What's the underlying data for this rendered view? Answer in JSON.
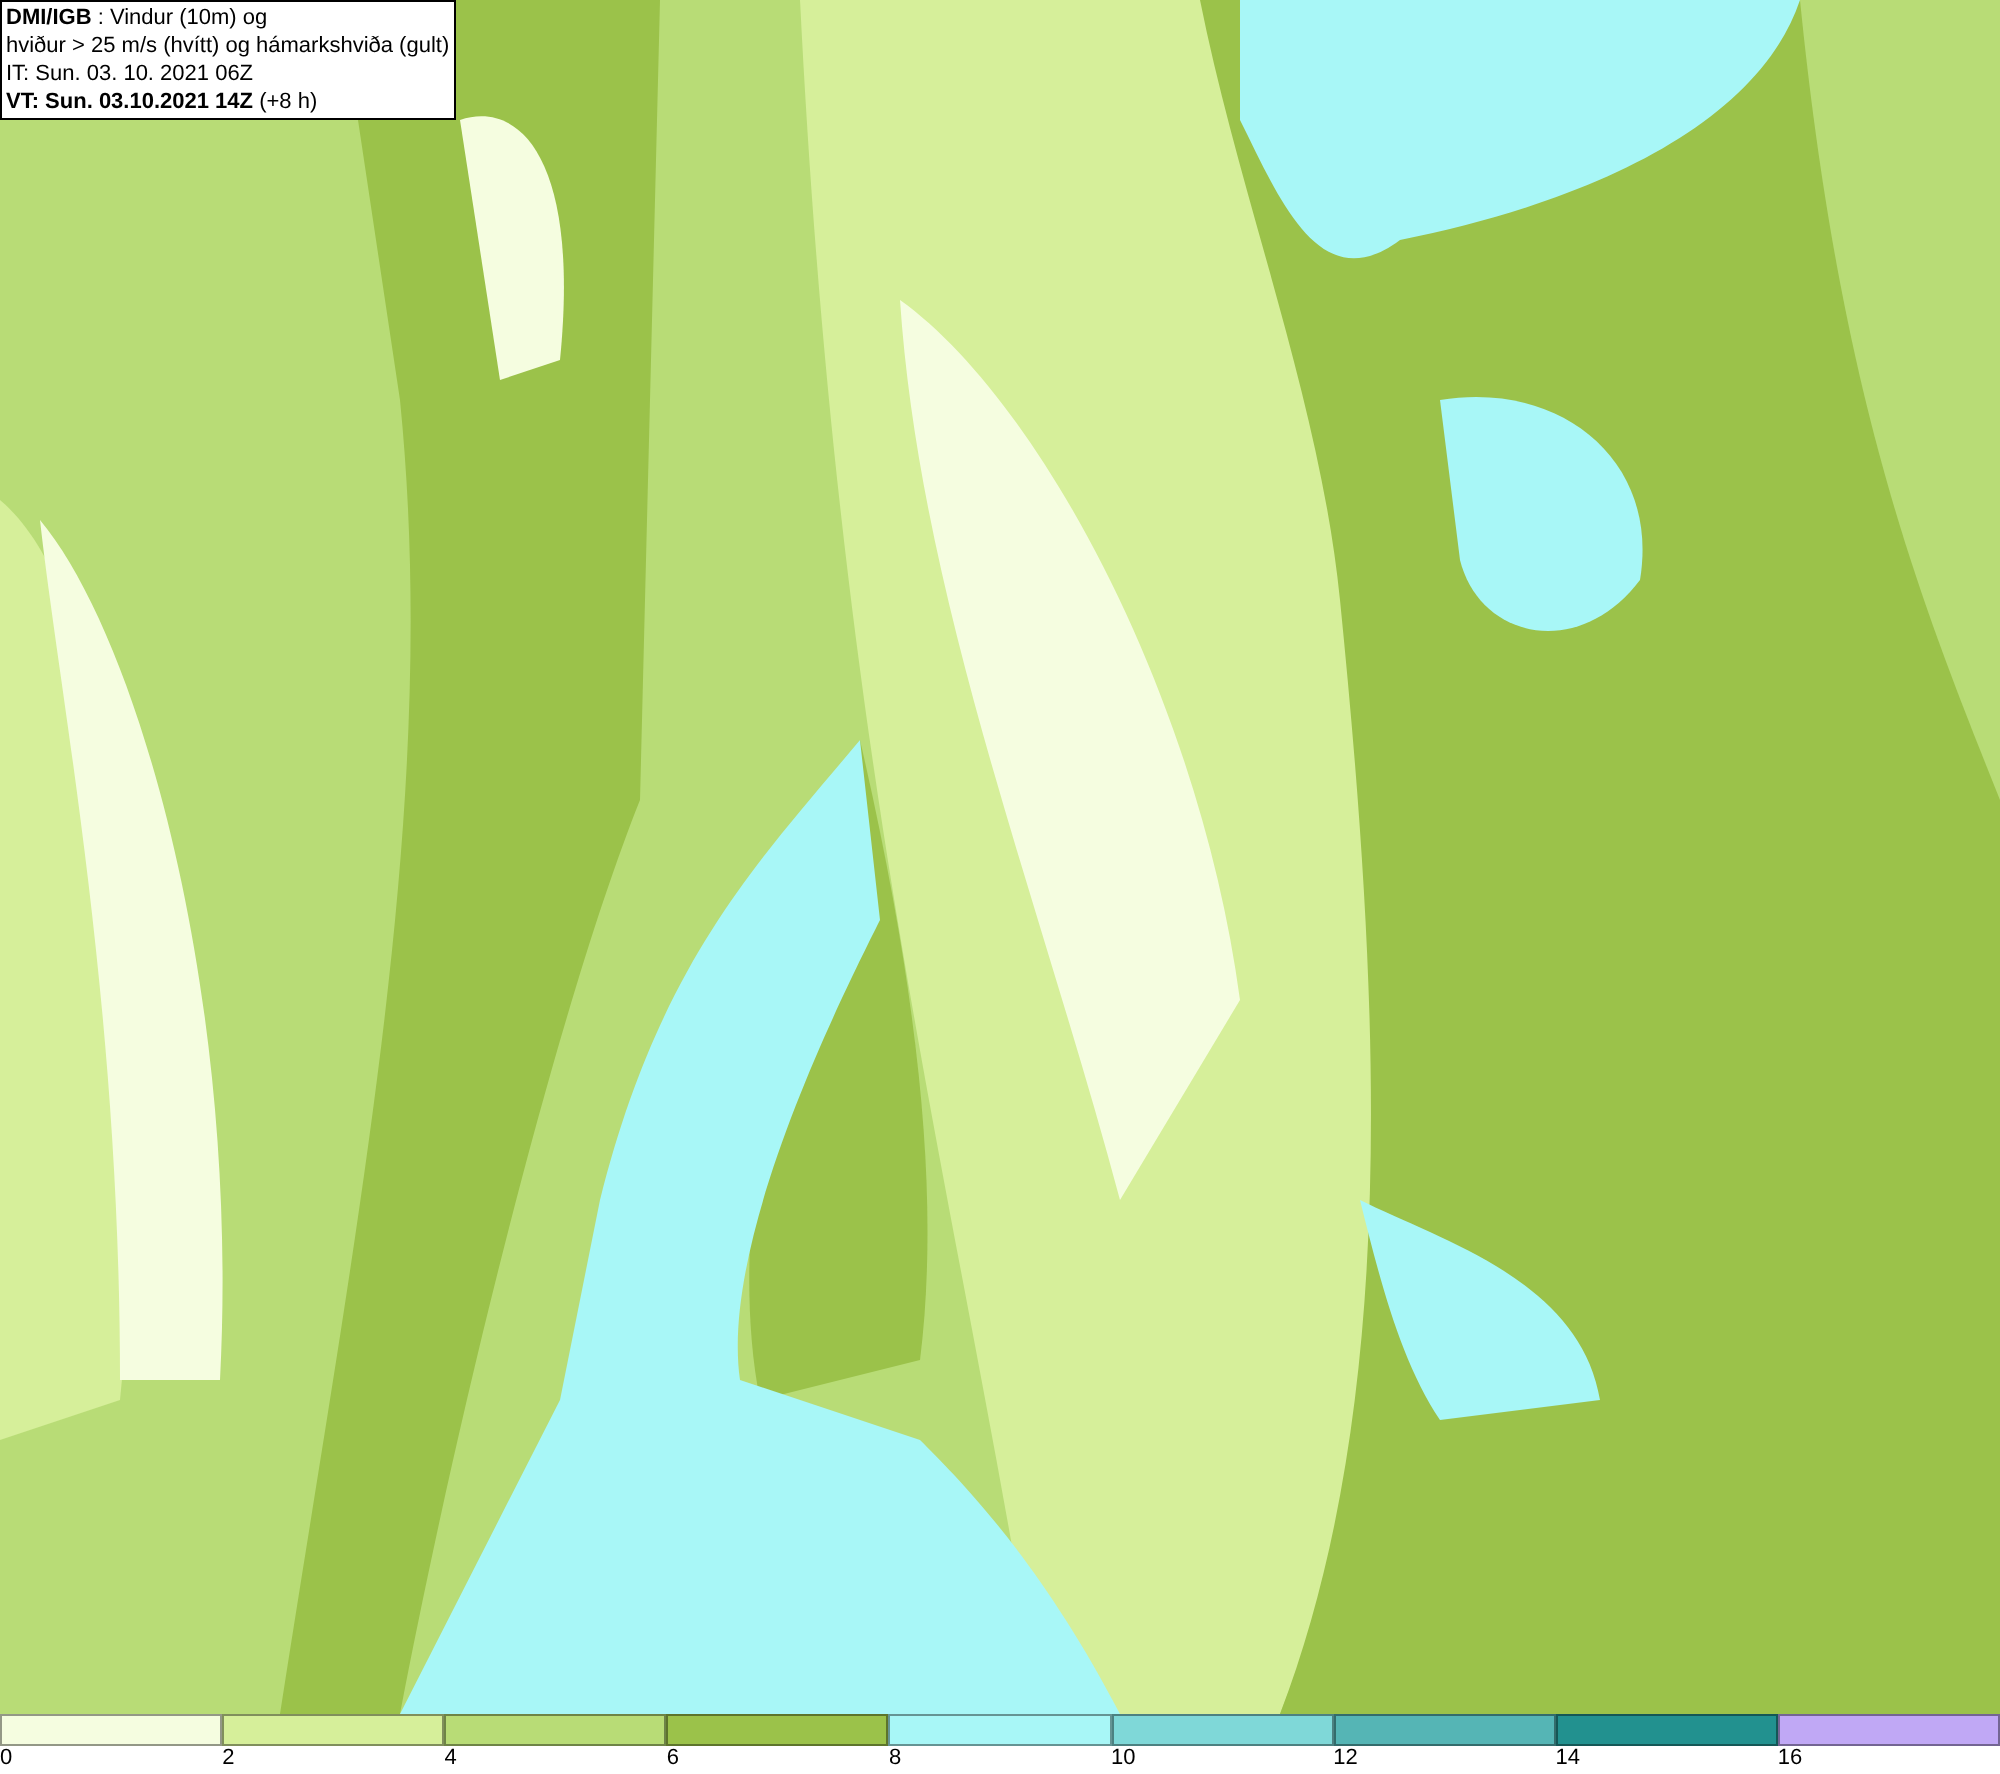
{
  "header": {
    "lines": [
      "**DMI/IGB** : Vindur (10m) og",
      "hviður > 25 m/s (hvítt) og hámarkshviða (gult)",
      "IT: Sun. 03. 10. 2021 06Z",
      "**VT: Sun. 03.10.2021 14Z** (+8 h)"
    ]
  },
  "legend": {
    "segments": [
      {
        "color": "#f5fde0",
        "label": "0"
      },
      {
        "color": "#d6ef9a",
        "label": "2"
      },
      {
        "color": "#b8dc76",
        "label": "4"
      },
      {
        "color": "#9bc24a",
        "label": "6"
      },
      {
        "color": "#a8f7f7",
        "label": "8"
      },
      {
        "color": "#7fd8d8",
        "label": "10"
      },
      {
        "color": "#55b5b5",
        "label": "12"
      },
      {
        "color": "#22918f",
        "label": "14"
      },
      {
        "color": "#c0a8f5",
        "label": "16"
      }
    ]
  }
}
